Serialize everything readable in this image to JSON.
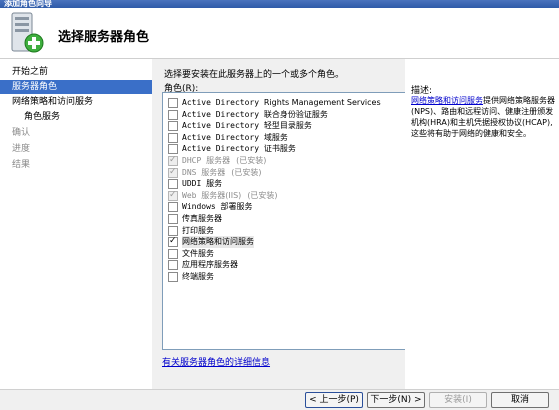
{
  "window": {
    "title": "添加角色向导"
  },
  "header": {
    "title": "选择服务器角色"
  },
  "steps": [
    {
      "label": "开始之前",
      "state": "normal",
      "indent": 0
    },
    {
      "label": "服务器角色",
      "state": "active",
      "indent": 0
    },
    {
      "label": "网络策略和访问服务",
      "state": "normal",
      "indent": 0
    },
    {
      "label": "角色服务",
      "state": "normal",
      "indent": 1
    },
    {
      "label": "确认",
      "state": "disabled",
      "indent": 0
    },
    {
      "label": "进度",
      "state": "disabled",
      "indent": 0
    },
    {
      "label": "结果",
      "state": "disabled",
      "indent": 0
    }
  ],
  "main": {
    "instruction": "选择要安装在此服务器上的一个或多个角色。",
    "roles_label": "角色(R):",
    "more_info_link": "有关服务器角色的详细信息"
  },
  "roles": [
    {
      "en": "Active Directory",
      "zh": "Rights Management Services",
      "checked": false,
      "disabled": false,
      "status": ""
    },
    {
      "en": "Active Directory",
      "zh": "联合身份验证服务",
      "checked": false,
      "disabled": false,
      "status": ""
    },
    {
      "en": "Active Directory",
      "zh": "轻型目录服务",
      "checked": false,
      "disabled": false,
      "status": ""
    },
    {
      "en": "Active Directory",
      "zh": "域服务",
      "checked": false,
      "disabled": false,
      "status": ""
    },
    {
      "en": "Active Directory",
      "zh": "证书服务",
      "checked": false,
      "disabled": false,
      "status": ""
    },
    {
      "en": "DHCP",
      "zh": "服务器",
      "checked": true,
      "disabled": true,
      "status": "(已安装)"
    },
    {
      "en": "DNS",
      "zh": "服务器",
      "checked": true,
      "disabled": true,
      "status": "(已安装)"
    },
    {
      "en": "UDDI",
      "zh": "服务",
      "checked": false,
      "disabled": false,
      "status": ""
    },
    {
      "en": "Web",
      "zh": "服务器(IIS)",
      "checked": true,
      "disabled": true,
      "status": "(已安装)"
    },
    {
      "en": "Windows",
      "zh": "部署服务",
      "checked": false,
      "disabled": false,
      "status": ""
    },
    {
      "en": "",
      "zh": "传真服务器",
      "checked": false,
      "disabled": false,
      "status": ""
    },
    {
      "en": "",
      "zh": "打印服务",
      "checked": false,
      "disabled": false,
      "status": ""
    },
    {
      "en": "",
      "zh": "网络策略和访问服务",
      "checked": true,
      "disabled": false,
      "status": "",
      "selected": true
    },
    {
      "en": "",
      "zh": "文件服务",
      "checked": false,
      "disabled": false,
      "status": ""
    },
    {
      "en": "",
      "zh": "应用程序服务器",
      "checked": false,
      "disabled": false,
      "status": ""
    },
    {
      "en": "",
      "zh": "终端服务",
      "checked": false,
      "disabled": false,
      "status": ""
    }
  ],
  "description": {
    "title": "描述:",
    "link_text": "网络策略和访问服务",
    "body": "提供网络策略服务器(NPS)、路由和远程访问、健康注册颁发机构(HRA)和主机凭据授权协议(HCAP),这些将有助于网络的健康和安全。"
  },
  "buttons": {
    "back": "< 上一步(P)",
    "next": "下一步(N) >",
    "install": "安装(I)",
    "cancel": "取消"
  },
  "colors": {
    "active_step_bg": "#3a6fc8",
    "link": "#0000cc",
    "pane_bg": "#f0f0f0"
  }
}
